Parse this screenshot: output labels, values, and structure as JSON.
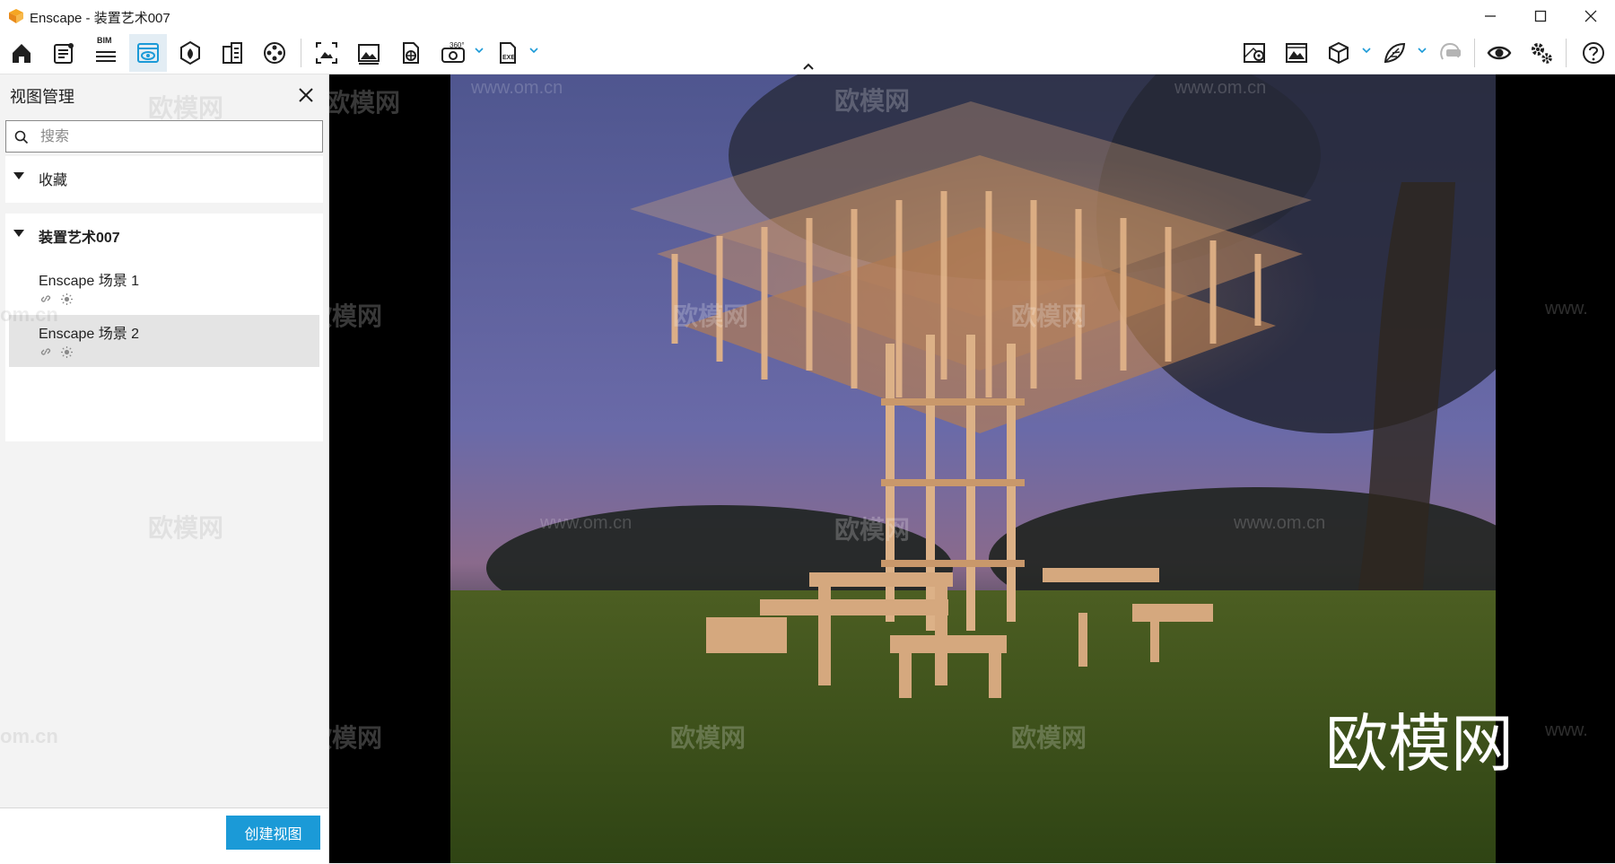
{
  "window": {
    "title": "Enscape - 装置艺术007",
    "accent_color": "#1b9ad7",
    "logo_icon": "enscape-logo-icon"
  },
  "toolbar": {
    "bim_label": "BIM",
    "pano_label": "360°",
    "exe_label": "EXE",
    "active_tool": "views-manager-icon"
  },
  "sidebar": {
    "title": "视图管理",
    "search_placeholder": "搜索",
    "favorites_label": "收藏",
    "project_label": "装置艺术007",
    "views": [
      {
        "name": "Enscape 场景 1"
      },
      {
        "name": "Enscape 场景 2"
      }
    ],
    "create_button": "创建视图"
  },
  "viewport": {
    "watermark_text": "欧模网",
    "watermark_url": "www.om.cn",
    "watermark_big": "欧模网",
    "watermark_side_url": "om.cn",
    "watermark_edge_url": "www."
  }
}
